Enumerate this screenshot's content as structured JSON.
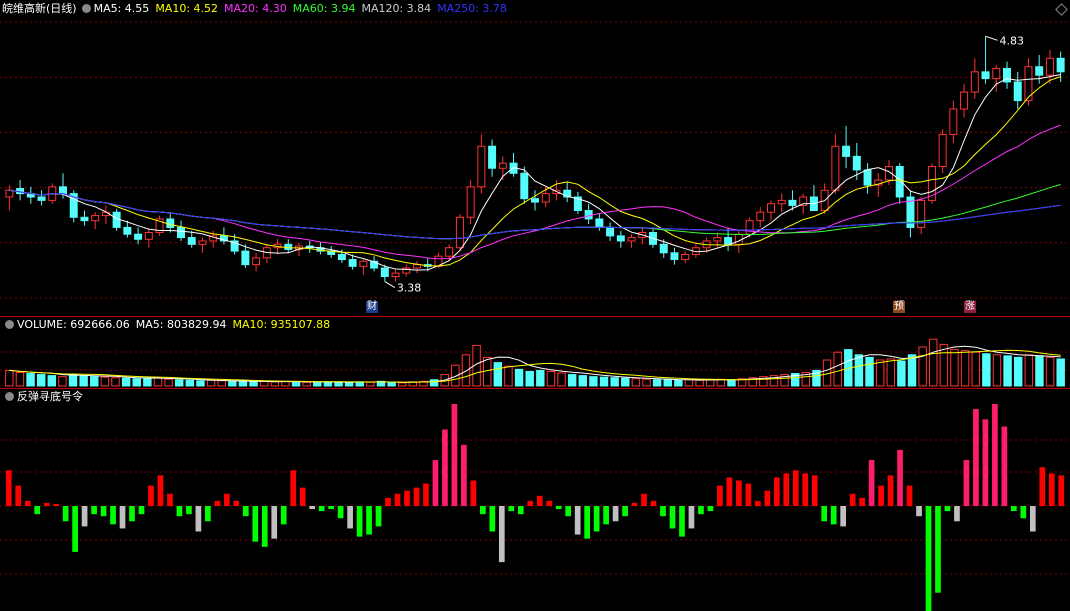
{
  "header": {
    "stock_name": "皖维高新(日线)",
    "ma_labels": [
      {
        "text": "MA5: 4.55",
        "color": "#ffffff"
      },
      {
        "text": "MA10: 4.52",
        "color": "#ffff00"
      },
      {
        "text": "MA20: 4.30",
        "color": "#ff33ff"
      },
      {
        "text": "MA60: 3.94",
        "color": "#33ff33"
      },
      {
        "text": "MA120: 3.84",
        "color": "#cccccc"
      },
      {
        "text": "MA250: 3.78",
        "color": "#3333ff"
      }
    ]
  },
  "volume_header": {
    "labels": [
      {
        "text": "VOLUME: 692666.06",
        "color": "#ffffff"
      },
      {
        "text": "MA5: 803829.94",
        "color": "#ffffff"
      },
      {
        "text": "MA10: 935107.88",
        "color": "#ffff00"
      }
    ]
  },
  "indicator_header": {
    "label": "反弹寻底号令"
  },
  "markers": {
    "cai": "财",
    "yu": "预",
    "zhang": "涨",
    "high_label": "4.83",
    "low_label": "3.38"
  },
  "colors": {
    "up": "#ff3333",
    "down": "#54fcfc",
    "ma5": "#ffffff",
    "ma10": "#ffff00",
    "ma20": "#ff33ff",
    "ma60": "#33ff33",
    "ma120": "#cccccc",
    "ma250": "#3333ff",
    "grid": "#800000",
    "ind_pos": "#ff0000",
    "ind_pos_strong": "#ff1e6e",
    "ind_neg": "#00ff00",
    "ind_neg_weak": "#c0c0c0"
  },
  "chart_data": [
    {
      "type": "candlestick",
      "name": "price",
      "ylim": [
        3.2,
        4.95
      ],
      "high": 4.83,
      "low": 3.38,
      "ohlc": [
        [
          3.88,
          3.95,
          3.8,
          3.92
        ],
        [
          3.93,
          3.98,
          3.86,
          3.9
        ],
        [
          3.9,
          3.94,
          3.84,
          3.88
        ],
        [
          3.88,
          3.92,
          3.83,
          3.86
        ],
        [
          3.86,
          3.96,
          3.84,
          3.94
        ],
        [
          3.94,
          4.02,
          3.87,
          3.9
        ],
        [
          3.9,
          3.92,
          3.73,
          3.76
        ],
        [
          3.76,
          3.8,
          3.71,
          3.74
        ],
        [
          3.74,
          3.79,
          3.69,
          3.77
        ],
        [
          3.77,
          3.83,
          3.72,
          3.79
        ],
        [
          3.79,
          3.81,
          3.68,
          3.7
        ],
        [
          3.7,
          3.74,
          3.64,
          3.66
        ],
        [
          3.66,
          3.7,
          3.6,
          3.63
        ],
        [
          3.63,
          3.69,
          3.58,
          3.67
        ],
        [
          3.67,
          3.77,
          3.65,
          3.75
        ],
        [
          3.75,
          3.79,
          3.67,
          3.7
        ],
        [
          3.7,
          3.74,
          3.62,
          3.64
        ],
        [
          3.64,
          3.68,
          3.58,
          3.6
        ],
        [
          3.6,
          3.64,
          3.55,
          3.62
        ],
        [
          3.62,
          3.68,
          3.58,
          3.65
        ],
        [
          3.65,
          3.7,
          3.6,
          3.62
        ],
        [
          3.62,
          3.66,
          3.54,
          3.56
        ],
        [
          3.56,
          3.6,
          3.46,
          3.48
        ],
        [
          3.48,
          3.55,
          3.44,
          3.52
        ],
        [
          3.52,
          3.6,
          3.49,
          3.58
        ],
        [
          3.58,
          3.63,
          3.54,
          3.6
        ],
        [
          3.6,
          3.63,
          3.55,
          3.57
        ],
        [
          3.57,
          3.61,
          3.53,
          3.59
        ],
        [
          3.59,
          3.62,
          3.55,
          3.58
        ],
        [
          3.58,
          3.61,
          3.54,
          3.56
        ],
        [
          3.56,
          3.59,
          3.52,
          3.54
        ],
        [
          3.54,
          3.57,
          3.49,
          3.51
        ],
        [
          3.51,
          3.54,
          3.45,
          3.47
        ],
        [
          3.47,
          3.51,
          3.42,
          3.5
        ],
        [
          3.5,
          3.53,
          3.44,
          3.46
        ],
        [
          3.46,
          3.48,
          3.38,
          3.41
        ],
        [
          3.41,
          3.45,
          3.38,
          3.43
        ],
        [
          3.43,
          3.48,
          3.41,
          3.46
        ],
        [
          3.46,
          3.5,
          3.43,
          3.48
        ],
        [
          3.48,
          3.52,
          3.44,
          3.47
        ],
        [
          3.47,
          3.55,
          3.46,
          3.53
        ],
        [
          3.53,
          3.6,
          3.5,
          3.58
        ],
        [
          3.58,
          3.78,
          3.57,
          3.76
        ],
        [
          3.76,
          3.98,
          3.72,
          3.94
        ],
        [
          3.94,
          4.25,
          3.9,
          4.18
        ],
        [
          4.18,
          4.22,
          4.0,
          4.05
        ],
        [
          4.05,
          4.12,
          3.98,
          4.08
        ],
        [
          4.08,
          4.14,
          4.0,
          4.02
        ],
        [
          4.02,
          4.06,
          3.84,
          3.87
        ],
        [
          3.87,
          3.92,
          3.8,
          3.85
        ],
        [
          3.85,
          3.94,
          3.82,
          3.9
        ],
        [
          3.9,
          3.98,
          3.86,
          3.92
        ],
        [
          3.92,
          3.97,
          3.85,
          3.88
        ],
        [
          3.88,
          3.91,
          3.78,
          3.8
        ],
        [
          3.8,
          3.84,
          3.72,
          3.75
        ],
        [
          3.75,
          3.78,
          3.68,
          3.7
        ],
        [
          3.7,
          3.73,
          3.62,
          3.65
        ],
        [
          3.65,
          3.68,
          3.58,
          3.62
        ],
        [
          3.62,
          3.66,
          3.58,
          3.64
        ],
        [
          3.64,
          3.7,
          3.6,
          3.67
        ],
        [
          3.67,
          3.7,
          3.58,
          3.6
        ],
        [
          3.6,
          3.63,
          3.52,
          3.55
        ],
        [
          3.55,
          3.58,
          3.48,
          3.51
        ],
        [
          3.51,
          3.56,
          3.49,
          3.54
        ],
        [
          3.54,
          3.6,
          3.52,
          3.58
        ],
        [
          3.58,
          3.64,
          3.55,
          3.62
        ],
        [
          3.62,
          3.67,
          3.58,
          3.64
        ],
        [
          3.64,
          3.7,
          3.56,
          3.6
        ],
        [
          3.6,
          3.68,
          3.55,
          3.66
        ],
        [
          3.66,
          3.76,
          3.64,
          3.74
        ],
        [
          3.74,
          3.82,
          3.7,
          3.79
        ],
        [
          3.79,
          3.86,
          3.74,
          3.84
        ],
        [
          3.84,
          3.9,
          3.79,
          3.86
        ],
        [
          3.86,
          3.92,
          3.8,
          3.83
        ],
        [
          3.83,
          3.9,
          3.78,
          3.88
        ],
        [
          3.88,
          3.95,
          3.84,
          3.8
        ],
        [
          3.8,
          3.96,
          3.78,
          3.92
        ],
        [
          3.92,
          4.25,
          3.9,
          4.18
        ],
        [
          4.18,
          4.3,
          4.05,
          4.12
        ],
        [
          4.12,
          4.2,
          3.98,
          4.04
        ],
        [
          4.04,
          4.08,
          3.9,
          3.95
        ],
        [
          3.95,
          4.02,
          3.88,
          3.98
        ],
        [
          3.98,
          4.1,
          3.95,
          4.06
        ],
        [
          4.06,
          4.08,
          3.84,
          3.88
        ],
        [
          3.88,
          3.92,
          3.64,
          3.7
        ],
        [
          3.7,
          3.88,
          3.66,
          3.86
        ],
        [
          3.86,
          4.08,
          3.84,
          4.06
        ],
        [
          4.06,
          4.28,
          4.02,
          4.25
        ],
        [
          4.25,
          4.45,
          4.2,
          4.4
        ],
        [
          4.4,
          4.55,
          4.35,
          4.5
        ],
        [
          4.5,
          4.7,
          4.46,
          4.62
        ],
        [
          4.62,
          4.83,
          4.55,
          4.58
        ],
        [
          4.58,
          4.66,
          4.5,
          4.64
        ],
        [
          4.64,
          4.68,
          4.52,
          4.56
        ],
        [
          4.56,
          4.62,
          4.4,
          4.45
        ],
        [
          4.45,
          4.7,
          4.42,
          4.65
        ],
        [
          4.65,
          4.72,
          4.55,
          4.6
        ],
        [
          4.6,
          4.75,
          4.55,
          4.7
        ],
        [
          4.7,
          4.74,
          4.56,
          4.62
        ]
      ],
      "ma_series": [
        "ma5",
        "ma10",
        "ma20",
        "ma60",
        "ma120",
        "ma250"
      ]
    },
    {
      "type": "bar",
      "name": "volume",
      "ylim": [
        0,
        100
      ],
      "values": [
        30,
        26,
        24,
        22,
        20,
        18,
        22,
        20,
        18,
        17,
        16,
        15,
        14,
        15,
        16,
        13,
        12,
        11,
        10,
        11,
        10,
        9,
        8,
        8,
        9,
        8,
        9,
        8,
        7,
        7,
        8,
        8,
        7,
        8,
        7,
        9,
        7,
        6,
        8,
        9,
        12,
        22,
        40,
        60,
        78,
        55,
        45,
        38,
        32,
        28,
        30,
        28,
        25,
        22,
        20,
        18,
        17,
        16,
        15,
        14,
        13,
        12,
        12,
        11,
        12,
        11,
        12,
        13,
        12,
        14,
        16,
        18,
        20,
        22,
        24,
        26,
        30,
        50,
        65,
        70,
        60,
        55,
        50,
        52,
        48,
        60,
        75,
        90,
        80,
        70,
        68,
        65,
        62,
        60,
        58,
        55,
        60,
        58,
        55,
        52
      ]
    },
    {
      "type": "bar",
      "name": "反弹寻底号令",
      "ylim": [
        -100,
        100
      ],
      "values": [
        35,
        20,
        5,
        -8,
        3,
        2,
        -15,
        -45,
        -20,
        -8,
        -10,
        -18,
        -22,
        -15,
        -8,
        20,
        30,
        12,
        -10,
        -8,
        -25,
        -15,
        5,
        12,
        5,
        -10,
        -35,
        -40,
        -32,
        -18,
        35,
        18,
        -3,
        -5,
        -3,
        -12,
        -22,
        -30,
        -28,
        -20,
        8,
        12,
        15,
        18,
        22,
        45,
        75,
        100,
        60,
        25,
        -8,
        -25,
        -55,
        -5,
        -8,
        5,
        10,
        5,
        -3,
        -10,
        -28,
        -32,
        -25,
        -18,
        -15,
        -10,
        3,
        12,
        5,
        -10,
        -22,
        -30,
        -22,
        -8,
        -5,
        20,
        28,
        25,
        22,
        5,
        15,
        28,
        32,
        35,
        32,
        30,
        -15,
        -18,
        -20,
        12,
        8,
        45,
        20,
        30,
        55,
        20,
        -10,
        -110,
        -85,
        -5,
        -15,
        45,
        95,
        85,
        100,
        78,
        -5,
        -12,
        -25,
        38,
        32,
        30
      ]
    }
  ]
}
